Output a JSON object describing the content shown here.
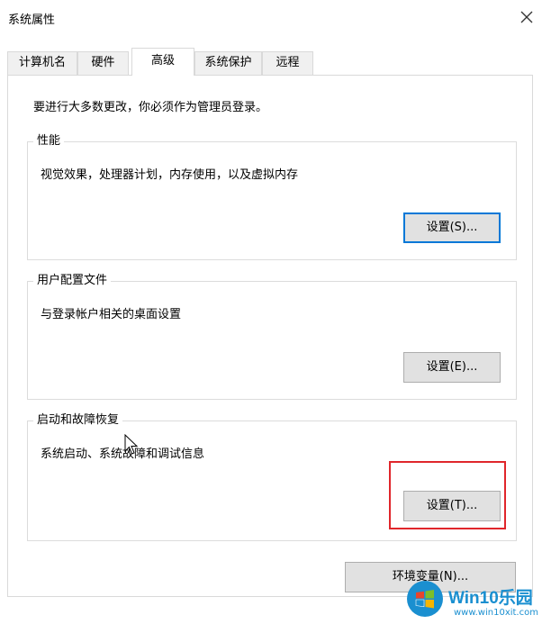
{
  "window": {
    "title": "系统属性"
  },
  "tabs": [
    {
      "label": "计算机名",
      "active": false
    },
    {
      "label": "硬件",
      "active": false
    },
    {
      "label": "高级",
      "active": true
    },
    {
      "label": "系统保护",
      "active": false
    },
    {
      "label": "远程",
      "active": false
    }
  ],
  "intro": "要进行大多数更改，你必须作为管理员登录。",
  "groups": {
    "performance": {
      "legend": "性能",
      "description": "视觉效果，处理器计划，内存使用，以及虚拟内存",
      "button": "设置(S)..."
    },
    "user_profiles": {
      "legend": "用户配置文件",
      "description": "与登录帐户相关的桌面设置",
      "button": "设置(E)..."
    },
    "startup_recovery": {
      "legend": "启动和故障恢复",
      "description": "系统启动、系统故障和调试信息",
      "button": "设置(T)..."
    }
  },
  "env_button": "环境变量(N)...",
  "watermark": {
    "brand": "Win10乐园",
    "url": "www.win10xit.com"
  },
  "colors": {
    "focus_border": "#0078d7",
    "highlight_box": "#e0262b",
    "watermark_blue": "#1a8fd0"
  }
}
